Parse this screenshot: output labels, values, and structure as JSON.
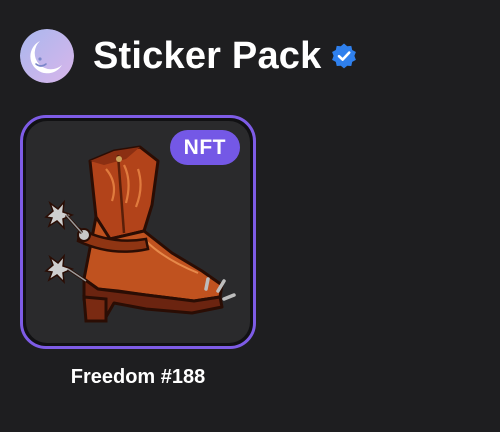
{
  "header": {
    "title": "Sticker Pack",
    "avatar_icon": "moon-face-icon",
    "verified_icon": "verified-badge-icon"
  },
  "sticker": {
    "badge_label": "NFT",
    "caption": "Freedom #188",
    "image_icon": "cowboy-boot-sticker"
  },
  "colors": {
    "background": "#1e1e20",
    "card_border": "#7e5ce6",
    "badge": "#7458e6",
    "verified": "#2f80ed"
  }
}
